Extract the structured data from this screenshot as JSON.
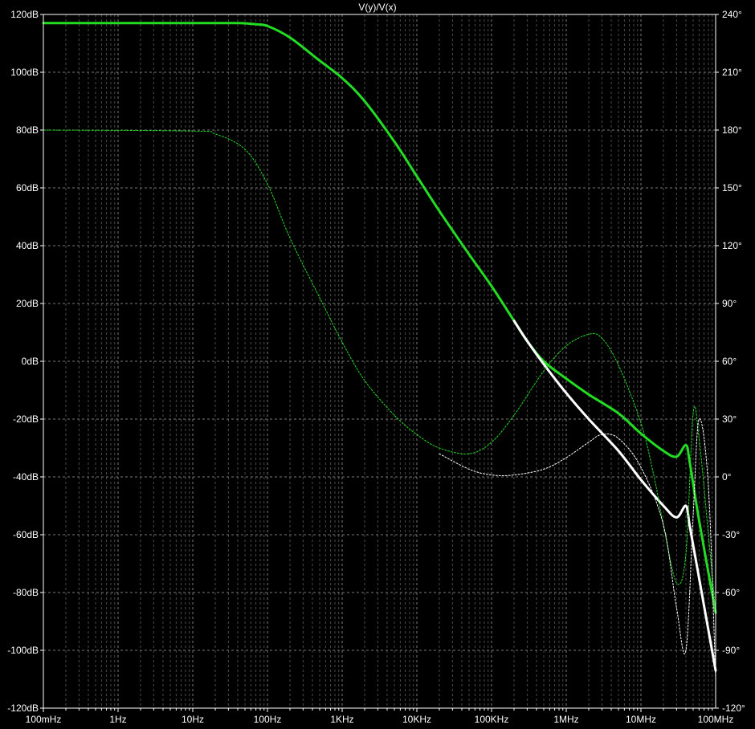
{
  "chart_data": {
    "type": "line",
    "title": "V(y)/V(x)",
    "x_scale": "log",
    "xlim": [
      0.1,
      100000000
    ],
    "x_ticks": [
      {
        "value": 0.1,
        "label": "100mHz"
      },
      {
        "value": 1,
        "label": "1Hz"
      },
      {
        "value": 10,
        "label": "10Hz"
      },
      {
        "value": 100,
        "label": "100Hz"
      },
      {
        "value": 1000,
        "label": "1KHz"
      },
      {
        "value": 10000,
        "label": "10KHz"
      },
      {
        "value": 100000,
        "label": "100KHz"
      },
      {
        "value": 1000000,
        "label": "1MHz"
      },
      {
        "value": 10000000,
        "label": "10MHz"
      },
      {
        "value": 100000000,
        "label": "100MHz"
      }
    ],
    "ylim_left": [
      -120,
      120
    ],
    "y_ticks_left": [
      {
        "value": 120,
        "label": "120dB"
      },
      {
        "value": 100,
        "label": "100dB"
      },
      {
        "value": 80,
        "label": "80dB"
      },
      {
        "value": 60,
        "label": "60dB"
      },
      {
        "value": 40,
        "label": "40dB"
      },
      {
        "value": 20,
        "label": "20dB"
      },
      {
        "value": 0,
        "label": "0dB"
      },
      {
        "value": -20,
        "label": "-20dB"
      },
      {
        "value": -40,
        "label": "-40dB"
      },
      {
        "value": -60,
        "label": "-60dB"
      },
      {
        "value": -80,
        "label": "-80dB"
      },
      {
        "value": -100,
        "label": "-100dB"
      },
      {
        "value": -120,
        "label": "-120dB"
      }
    ],
    "ylim_right": [
      -120,
      240
    ],
    "y_ticks_right": [
      {
        "value": 240,
        "label": "240°"
      },
      {
        "value": 210,
        "label": "210°"
      },
      {
        "value": 180,
        "label": "180°"
      },
      {
        "value": 150,
        "label": "150°"
      },
      {
        "value": 120,
        "label": "120°"
      },
      {
        "value": 90,
        "label": "90°"
      },
      {
        "value": 60,
        "label": "60°"
      },
      {
        "value": 30,
        "label": "30°"
      },
      {
        "value": 0,
        "label": "0°"
      },
      {
        "value": -30,
        "label": "-30°"
      },
      {
        "value": -60,
        "label": "-60°"
      },
      {
        "value": -90,
        "label": "-90°"
      },
      {
        "value": -120,
        "label": "-120°"
      }
    ],
    "grid": true,
    "background": "#000000",
    "series": [
      {
        "id": "green-magnitude",
        "axis": "left",
        "style": "solid",
        "color": "#22dd22",
        "x": [
          0.1,
          10,
          40,
          70,
          100,
          200,
          500,
          1000,
          2000,
          5000,
          10000,
          20000,
          50000,
          100000,
          200000,
          300000,
          500000,
          1000000,
          2000000,
          5000000,
          10000000,
          20000000,
          30000000,
          40000000,
          45000000,
          60000000,
          100000000
        ],
        "y": [
          117,
          117,
          117,
          116.6,
          116,
          112,
          104,
          98,
          90,
          76,
          64,
          52,
          37,
          26,
          14,
          7,
          0,
          -6,
          -11.5,
          -18,
          -25,
          -31,
          -33,
          -29,
          -35,
          -55,
          -87
        ]
      },
      {
        "id": "white-magnitude",
        "axis": "left",
        "style": "solid",
        "color": "#ffffff",
        "x": [
          200000,
          300000,
          500000,
          1000000,
          2000000,
          5000000,
          10000000,
          20000000,
          30000000,
          40000000,
          45000000,
          60000000,
          100000000
        ],
        "y": [
          14,
          7,
          -1,
          -11,
          -20,
          -31,
          -41,
          -50,
          -54,
          -50,
          -57,
          -75,
          -107
        ]
      },
      {
        "id": "green-phase",
        "axis": "right",
        "style": "dashed",
        "color": "#22dd22",
        "x": [
          0.1,
          10,
          20,
          50,
          100,
          200,
          500,
          1000,
          2000,
          5000,
          10000,
          20000,
          50000,
          100000,
          200000,
          500000,
          1000000,
          2000000,
          3000000,
          5000000,
          10000000,
          15000000,
          20000000,
          30000000,
          40000000,
          50000000,
          60000000,
          80000000,
          100000000
        ],
        "y": [
          180,
          179.5,
          178,
          170,
          152,
          124,
          93,
          70,
          50,
          32,
          22,
          15,
          12,
          18,
          32,
          55,
          68,
          74,
          72,
          58,
          28,
          0,
          -25,
          -55,
          -40,
          33,
          20,
          -30,
          -70
        ]
      },
      {
        "id": "white-phase",
        "axis": "right",
        "style": "dashed",
        "color": "#ffffff",
        "x": [
          20000,
          50000,
          100000,
          200000,
          500000,
          1000000,
          2000000,
          3000000,
          5000000,
          10000000,
          20000000,
          30000000,
          40000000,
          50000000,
          60000000,
          80000000,
          100000000
        ],
        "y": [
          12,
          4,
          1,
          1,
          4,
          10,
          18,
          22,
          20,
          5,
          -25,
          -68,
          -90,
          -20,
          30,
          -5,
          -105
        ]
      }
    ]
  }
}
